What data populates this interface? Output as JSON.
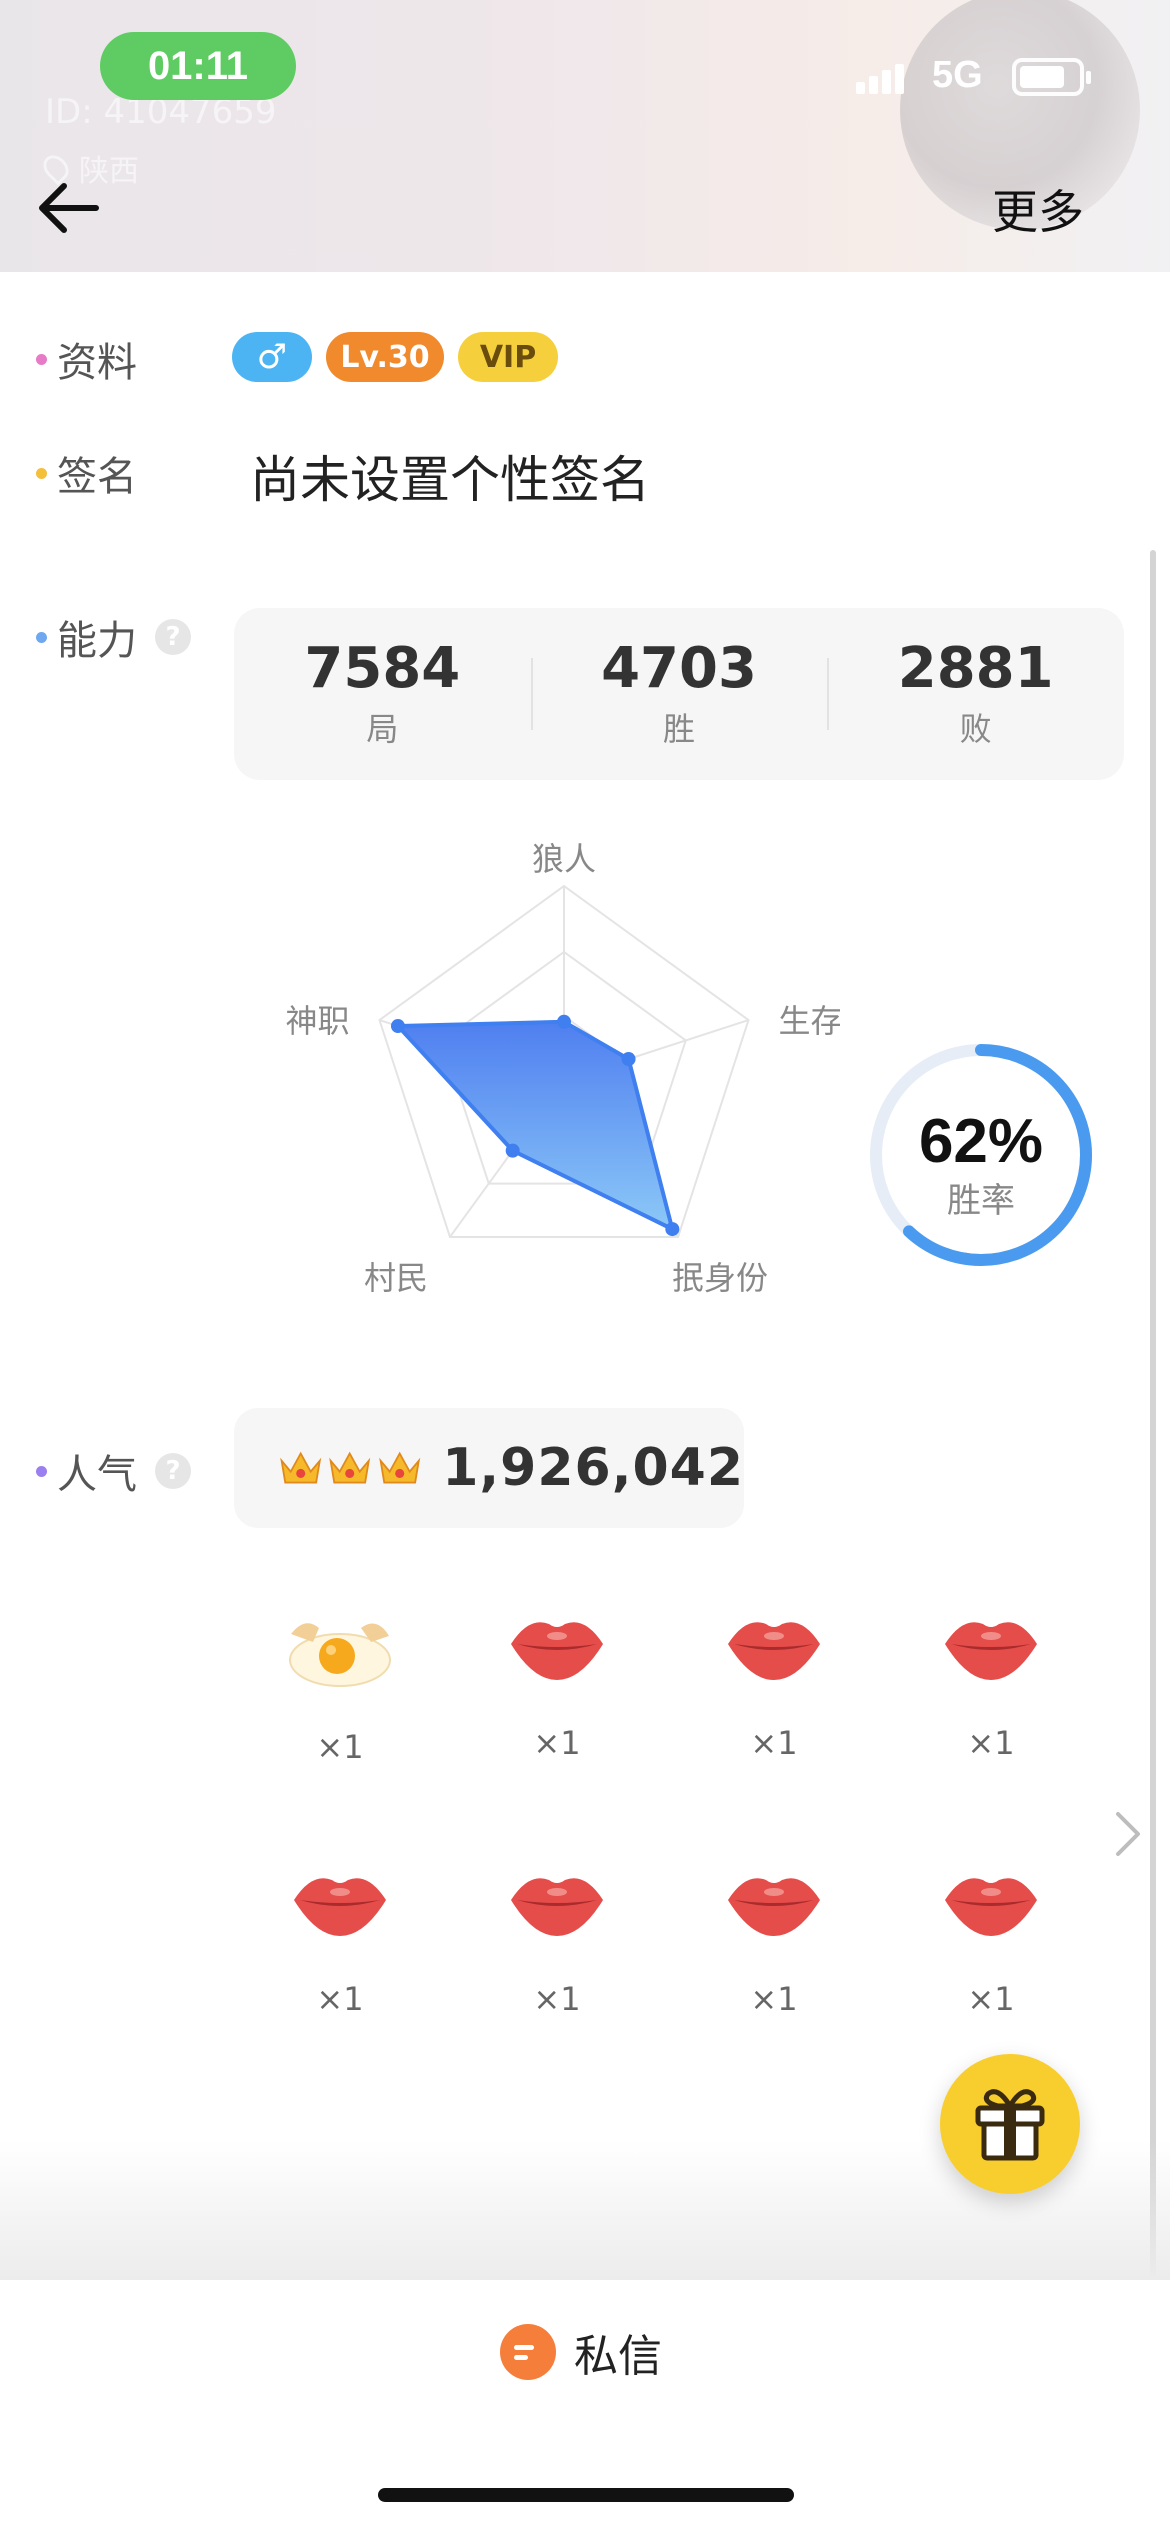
{
  "status_bar": {
    "time": "01:11",
    "network": "5G"
  },
  "header": {
    "faint_id": "ID: 41047659",
    "faint_location": "陕西",
    "more_label": "更多"
  },
  "profile": {
    "info_label": "资料",
    "gender_symbol": "♂",
    "level": "Lv.30",
    "vip": "VIP",
    "signature_label": "签名",
    "signature": "尚未设置个性签名"
  },
  "ability": {
    "label": "能力",
    "help": "?",
    "stats": [
      {
        "value": "7584",
        "caption": "局"
      },
      {
        "value": "4703",
        "caption": "胜"
      },
      {
        "value": "2881",
        "caption": "败"
      }
    ]
  },
  "chart_data": {
    "type": "radar",
    "axes": [
      "狼人",
      "生存",
      "抿身份",
      "村民",
      "神职"
    ],
    "values": [
      0.3,
      0.35,
      0.95,
      0.45,
      0.9
    ],
    "fill_color_top": "#4f7ff0",
    "fill_color_bottom": "#8cc8f7"
  },
  "win_rate": {
    "percent": 62,
    "value_label": "62%",
    "caption": "胜率",
    "color": "#4a9bef"
  },
  "popularity": {
    "label": "人气",
    "help": "?",
    "value": "1,926,042",
    "crowns": 3
  },
  "gifts": [
    {
      "icon": "egg-icon",
      "count": "×1"
    },
    {
      "icon": "lips-icon",
      "count": "×1"
    },
    {
      "icon": "lips-icon",
      "count": "×1"
    },
    {
      "icon": "lips-icon",
      "count": "×1"
    },
    {
      "icon": "lips-icon",
      "count": "×1"
    },
    {
      "icon": "lips-icon",
      "count": "×1"
    },
    {
      "icon": "lips-icon",
      "count": "×1"
    },
    {
      "icon": "lips-icon",
      "count": "×1"
    }
  ],
  "bottom": {
    "dm_label": "私信"
  }
}
